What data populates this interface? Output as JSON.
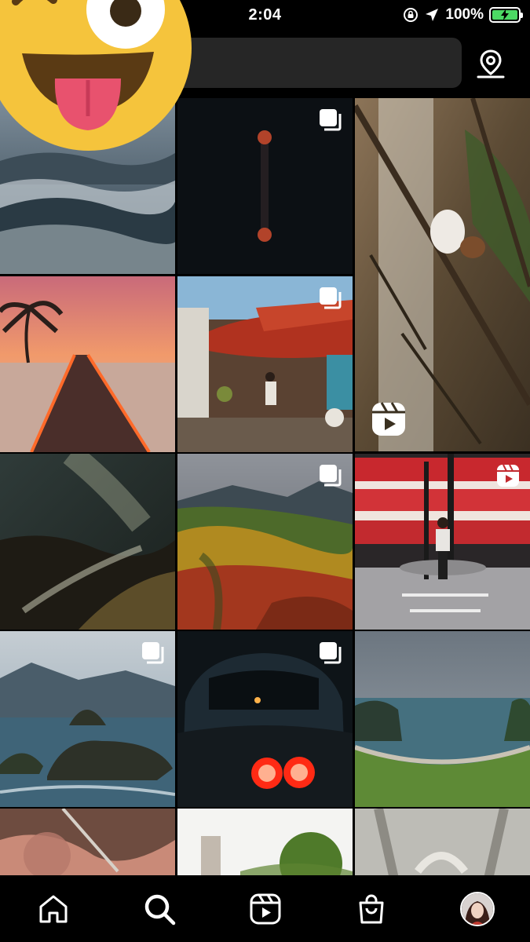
{
  "status_bar": {
    "time": "2:04",
    "battery_percent": "100%",
    "icons": [
      "orientation-lock-icon",
      "location-arrow-icon",
      "battery-charging-icon"
    ]
  },
  "search": {
    "placeholder": "",
    "map_icon": "map-pin-icon"
  },
  "grid": {
    "tiles": [
      {
        "subject": "misty-mountains",
        "badge": "none"
      },
      {
        "subject": "lunar-eclipse",
        "badge": "multiple-photos-icon"
      },
      {
        "subject": "cat-in-tree",
        "badge": "reels-icon"
      },
      {
        "subject": "sunset-pier",
        "badge": "none"
      },
      {
        "subject": "market-street",
        "badge": "multiple-photos-icon"
      },
      {
        "subject": "milky-way-river",
        "badge": "none"
      },
      {
        "subject": "autumn-valley",
        "badge": "multiple-photos-icon"
      },
      {
        "subject": "london-bus-street",
        "badge": "reels-icon"
      },
      {
        "subject": "sea-stacks",
        "badge": "multiple-photos-icon"
      },
      {
        "subject": "car-taillights",
        "badge": "multiple-photos-icon"
      },
      {
        "subject": "coastal-cliffs",
        "badge": "none"
      },
      {
        "subject": "partial-row",
        "badge": "none"
      }
    ]
  },
  "bottom_nav": {
    "items": [
      "home-icon",
      "search-icon",
      "reels-icon",
      "shop-icon",
      "profile-avatar"
    ],
    "active": "search-icon"
  },
  "colors": {
    "background": "#000000",
    "search_bg": "#262626",
    "battery_fill": "#4cd964"
  }
}
